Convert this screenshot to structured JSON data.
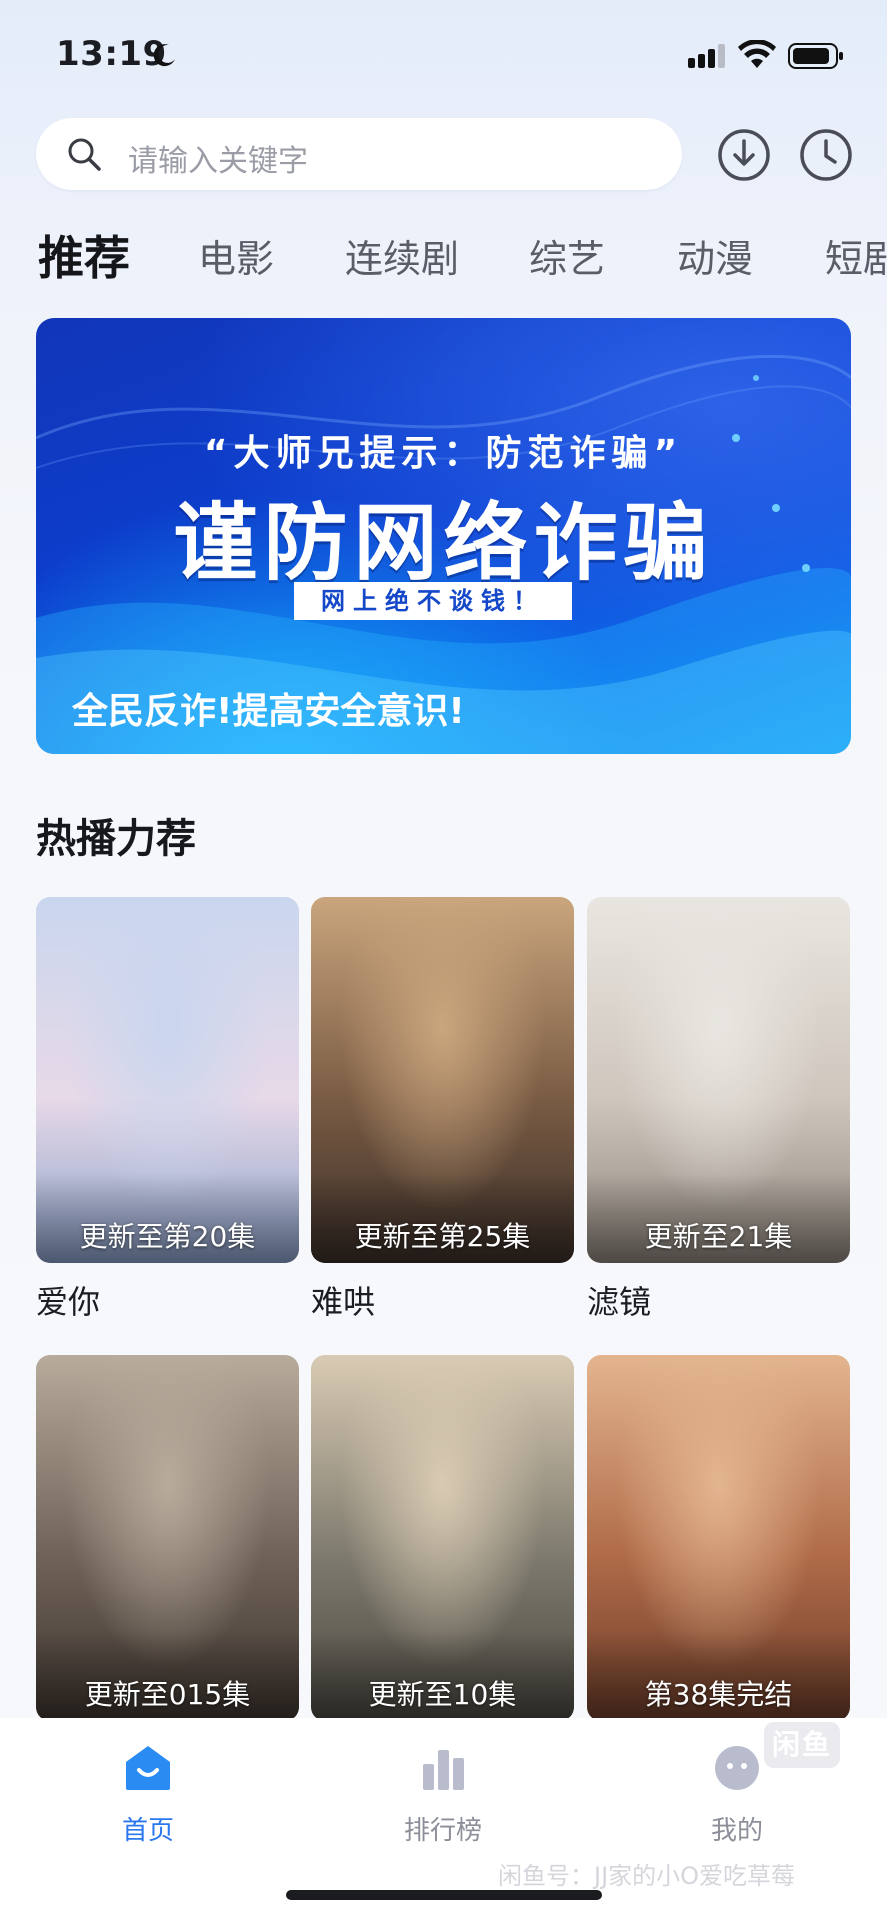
{
  "status_bar": {
    "time": "13:19"
  },
  "search": {
    "placeholder": "请输入关键字"
  },
  "tabs": [
    "推荐",
    "电影",
    "连续剧",
    "综艺",
    "动漫",
    "短剧"
  ],
  "banner": {
    "kicker": "“大师兄提示：防范诈骗”",
    "headline": "谨防网络诈骗",
    "tag": "网上绝不谈钱！",
    "footer": "全民反诈!提高安全意识!"
  },
  "section": {
    "title": "热播力荐"
  },
  "cards": [
    {
      "title": "爱你",
      "badge": "更新至第20集",
      "colors": [
        "#c9d6ee",
        "#e7d9e8",
        "#8aa0c8"
      ]
    },
    {
      "title": "难哄",
      "badge": "更新至第25集",
      "colors": [
        "#caa57d",
        "#7a5c44",
        "#3a2e28"
      ]
    },
    {
      "title": "滤镜",
      "badge": "更新至21集",
      "colors": [
        "#e9e6e1",
        "#cfc6bd",
        "#8d847c"
      ]
    },
    {
      "title": "",
      "badge": "更新至015集",
      "colors": [
        "#b7ab9c",
        "#6f6258",
        "#3e352f"
      ]
    },
    {
      "title": "",
      "badge": "更新至10集",
      "colors": [
        "#d9cbb3",
        "#7e7a6e",
        "#4a4740"
      ]
    },
    {
      "title": "",
      "badge": "第38集完结",
      "colors": [
        "#e3b58f",
        "#b06b48",
        "#6b3c2a"
      ]
    }
  ],
  "bottom_nav": [
    {
      "label": "首页",
      "icon": "home-icon",
      "active": true
    },
    {
      "label": "排行榜",
      "icon": "ranking-icon",
      "active": false
    },
    {
      "label": "我的",
      "icon": "profile-icon",
      "active": false
    }
  ],
  "watermark": {
    "logo": "闲鱼",
    "text": "闲鱼号：JJ家的小O爱吃草莓"
  },
  "colors": {
    "accent": "#2a78f0",
    "banner_blue": "#0b3fd0"
  }
}
